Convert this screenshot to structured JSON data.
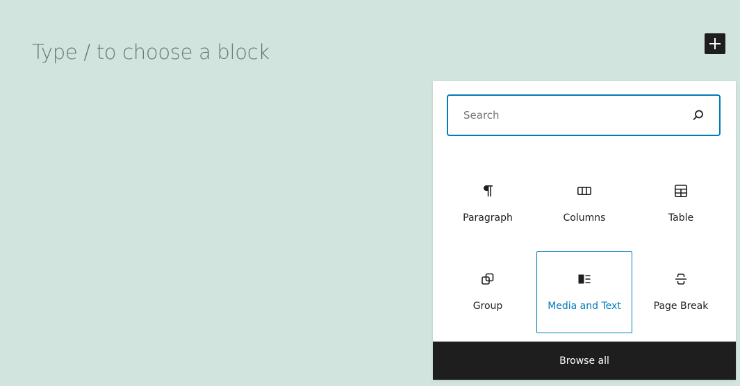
{
  "editor": {
    "placeholder": "Type / to choose a block"
  },
  "inserter": {
    "add_button_icon": "plus-icon",
    "search": {
      "placeholder": "Search",
      "value": "",
      "icon": "search-icon"
    },
    "blocks": [
      {
        "label": "Paragraph",
        "icon": "paragraph-icon"
      },
      {
        "label": "Columns",
        "icon": "columns-icon"
      },
      {
        "label": "Table",
        "icon": "table-icon"
      },
      {
        "label": "Group",
        "icon": "group-icon"
      },
      {
        "label": "Media and Text",
        "icon": "media-text-icon",
        "active": true
      },
      {
        "label": "Page Break",
        "icon": "page-break-icon"
      }
    ],
    "browse_all_label": "Browse all"
  },
  "colors": {
    "background": "#d1e4dd",
    "accent": "#007cba",
    "dark": "#1e1e1e"
  }
}
